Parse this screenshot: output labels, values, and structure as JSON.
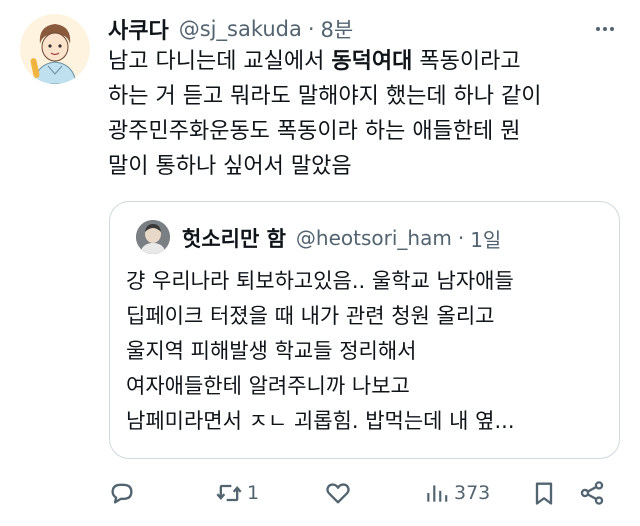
{
  "tweet": {
    "display_name": "사쿠다",
    "handle": "@sj_sakuda",
    "separator": "·",
    "time": "8분",
    "text_before": "남고 다니는데 교실에서 ",
    "text_highlight": "동덕여대",
    "text_after": " 폭동이라고\n하는 거 듣고 뭐라도 말해야지 했는데 하나 같이\n광주민주화운동도 폭동이라 하는 애들한테 뭔\n말이 통하나 싶어서 말았음"
  },
  "quote": {
    "display_name": "헛소리만 함",
    "handle": "@heotsori_ham",
    "separator": "·",
    "time": "1일",
    "text": "걍 우리나라 퇴보하고있음.. 울학교 남자애들\n딥페이크 터졌을 때 내가 관련 청원 올리고\n울지역 피해발생 학교들 정리해서\n여자애들한테 알려주니까 나보고\n남페미라면서 ㅈㄴ 괴롭힘. 밥먹는데 내 옆..."
  },
  "actions": {
    "reply_icon": "reply-icon",
    "retweet_icon": "retweet-icon",
    "retweet_count": "1",
    "like_icon": "like-icon",
    "views_icon": "views-icon",
    "views_count": "373",
    "bookmark_icon": "bookmark-icon",
    "share_icon": "share-icon"
  },
  "colors": {
    "text": "#0f1419",
    "secondary": "#536471",
    "border": "#cfd9de",
    "background": "#ffffff"
  }
}
